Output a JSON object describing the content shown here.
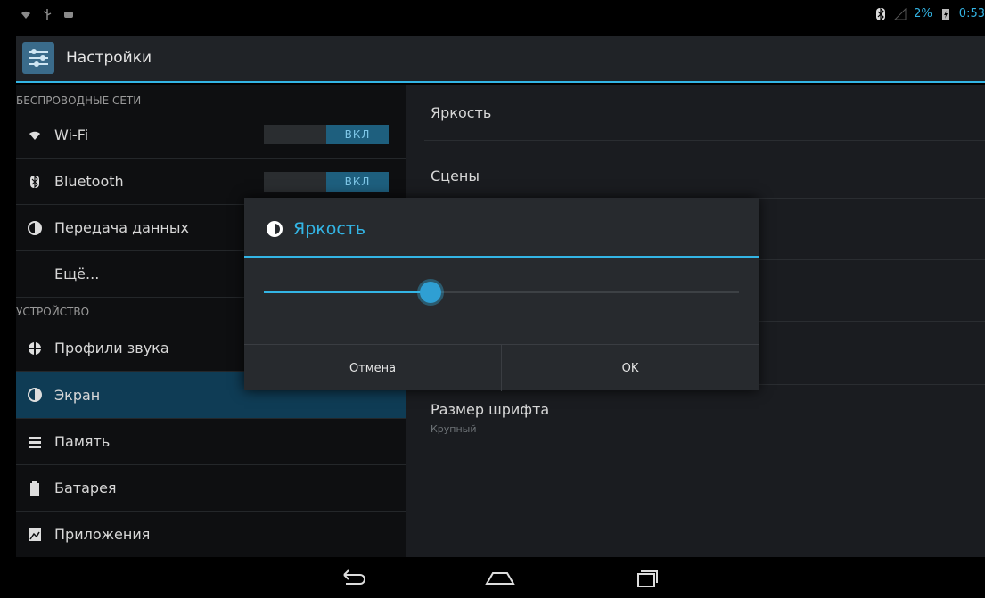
{
  "status_bar": {
    "battery_percent": "2%",
    "time": "0:53",
    "icons": [
      "wifi-icon",
      "usb-icon",
      "android-debug-icon",
      "bluetooth-icon",
      "signal-icon",
      "battery-icon"
    ]
  },
  "action_bar": {
    "title": "Настройки"
  },
  "sidebar": {
    "sections": [
      {
        "header": "БЕСПРОВОДНЫЕ СЕТИ"
      },
      {
        "header": "УСТРОЙСТВО"
      }
    ],
    "items": [
      {
        "label": "Wi-Fi",
        "icon": "wifi-icon",
        "toggle": "ВКЛ"
      },
      {
        "label": "Bluetooth",
        "icon": "bluetooth-icon",
        "toggle": "ВКЛ"
      },
      {
        "label": "Передача данных",
        "icon": "data-usage-icon"
      },
      {
        "label": "Ещё..."
      },
      {
        "label": "Профили звука",
        "icon": "sound-profile-icon"
      },
      {
        "label": "Экран",
        "icon": "display-icon",
        "selected": true
      },
      {
        "label": "Память",
        "icon": "storage-icon"
      },
      {
        "label": "Батарея",
        "icon": "battery-icon"
      },
      {
        "label": "Приложения",
        "icon": "apps-icon"
      }
    ]
  },
  "detail": {
    "items": [
      {
        "title": "Яркость"
      },
      {
        "title": "Сцены"
      },
      {
        "title": "Размер шрифта",
        "subtitle": "Крупный"
      }
    ]
  },
  "dialog": {
    "title": "Яркость",
    "icon": "brightness-icon",
    "slider_value": 0.35,
    "cancel_label": "Отмена",
    "ok_label": "OK"
  },
  "nav_bar": {
    "buttons": [
      "back-icon",
      "home-icon",
      "recent-apps-icon"
    ]
  },
  "colors": {
    "accent": "#33b5e5",
    "background": "#000000",
    "panel": "#1a1c20",
    "selected": "#0f3c55"
  }
}
